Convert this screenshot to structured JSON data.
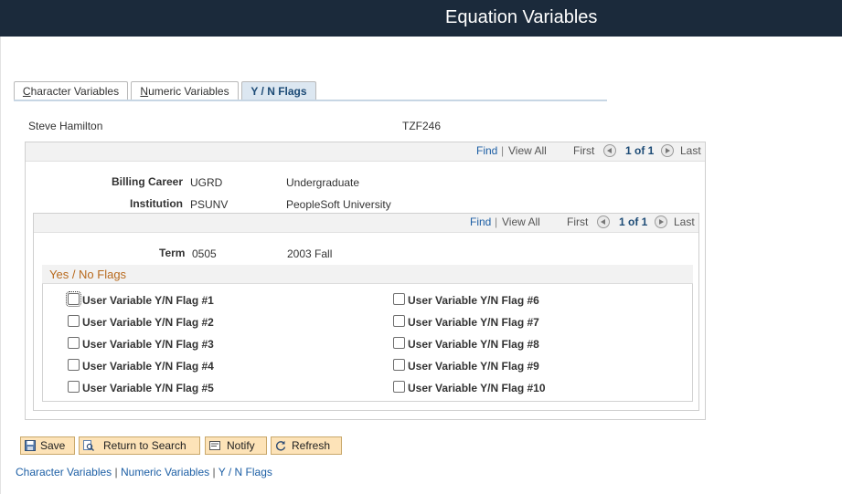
{
  "window": {
    "title": "Equation Variables"
  },
  "tabs": [
    {
      "label": "Character Variables",
      "ul": "C",
      "rest": "haracter Variables",
      "active": false
    },
    {
      "label": "Numeric Variables",
      "ul": "N",
      "rest": "umeric Variables",
      "active": false
    },
    {
      "label": "Y / N Flags",
      "active": true
    }
  ],
  "person": {
    "name": "Steve Hamilton",
    "id": "TZF246"
  },
  "outer_nav": {
    "find": "Find",
    "sep": "|",
    "view_all": "View All",
    "first": "First",
    "count": "1 of 1",
    "last": "Last"
  },
  "billing": {
    "career_label": "Billing Career",
    "career_code": "UGRD",
    "career_desc": "Undergraduate",
    "institution_label": "Institution",
    "institution_code": "PSUNV",
    "institution_desc": "PeopleSoft University"
  },
  "inner_nav": {
    "find": "Find",
    "sep": "|",
    "view_all": "View All",
    "first": "First",
    "count": "1 of 1",
    "last": "Last"
  },
  "term": {
    "label": "Term",
    "code": "0505",
    "desc": "2003 Fall"
  },
  "flags": {
    "title": "Yes / No Flags",
    "items": [
      {
        "label": "User Variable Y/N Flag #1",
        "checked": false
      },
      {
        "label": "User Variable Y/N Flag #2",
        "checked": false
      },
      {
        "label": "User Variable Y/N Flag #3",
        "checked": false
      },
      {
        "label": "User Variable Y/N Flag #4",
        "checked": false
      },
      {
        "label": "User Variable Y/N Flag #5",
        "checked": false
      },
      {
        "label": "User Variable Y/N Flag #6",
        "checked": false
      },
      {
        "label": "User Variable Y/N Flag #7",
        "checked": false
      },
      {
        "label": "User Variable Y/N Flag #8",
        "checked": false
      },
      {
        "label": "User Variable Y/N Flag #9",
        "checked": false
      },
      {
        "label": "User Variable Y/N Flag #10",
        "checked": false
      }
    ]
  },
  "toolbar": {
    "save": "Save",
    "save_icon": "floppy-disk-icon",
    "return": "Return to Search",
    "return_icon": "search-list-icon",
    "notify": "Notify",
    "notify_icon": "notify-icon",
    "refresh": "Refresh",
    "refresh_icon": "refresh-icon"
  },
  "bottom_links": {
    "character": "Character Variables",
    "numeric": "Numeric Variables",
    "flags": "Y / N Flags",
    "sep": "|"
  },
  "colors": {
    "titlebar": "#1b2a3b",
    "link": "#1d5fa5",
    "section_title": "#b86a1e",
    "button_bg": "#fde3b8",
    "active_tab": "#dce7f1"
  }
}
